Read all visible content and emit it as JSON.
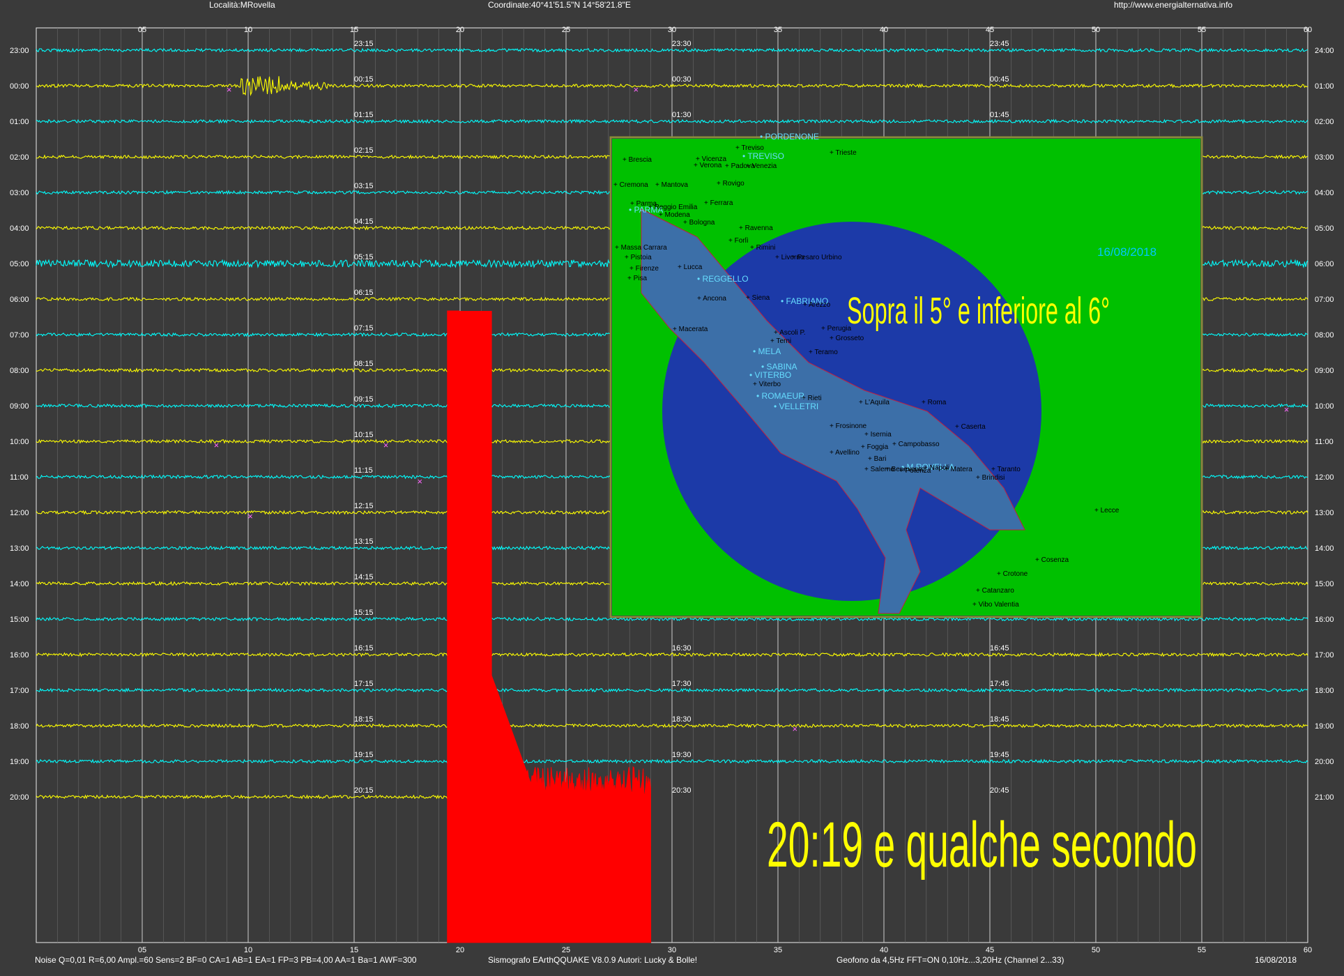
{
  "header": {
    "location": "Località:MRovella",
    "coordinates": "Coordinate:40°41'51.5\"N 14°58'21.8\"E",
    "url": "http://www.energialternativa.info"
  },
  "footer": {
    "params": "Noise Q=0,01 R=6,00 Ampl.=60 Sens=2 BF=0 CA=1 AB=1 EA=1 FP=3 PB=4,00 AA=1 Ba=1 AWF=300",
    "software": "Sismografo EArthQQUAKE  V8.0.9  Autori: Lucky & Bolle!",
    "geofono": "Geofono da 4,5Hz FFT=ON 0,10Hz...3,20Hz     (Channel 2...33)",
    "date": "16/08/2018"
  },
  "minute_ticks": [
    "05",
    "10",
    "15",
    "20",
    "25",
    "30",
    "35",
    "40",
    "45",
    "50",
    "55",
    "60"
  ],
  "rows": [
    {
      "left": "23:00",
      "right": "24:00",
      "color": "cyan",
      "marks": [
        "23:15",
        "23:30",
        "23:45"
      ]
    },
    {
      "left": "00:00",
      "right": "01:00",
      "color": "yellow",
      "marks": [
        "00:15",
        "00:30",
        "00:45"
      ]
    },
    {
      "left": "01:00",
      "right": "02:00",
      "color": "cyan",
      "marks": [
        "01:15",
        "01:30",
        "01:45"
      ]
    },
    {
      "left": "02:00",
      "right": "03:00",
      "color": "yellow",
      "marks": [
        "02:15",
        "",
        ""
      ]
    },
    {
      "left": "03:00",
      "right": "04:00",
      "color": "cyan",
      "marks": [
        "03:15",
        "",
        ""
      ]
    },
    {
      "left": "04:00",
      "right": "05:00",
      "color": "yellow",
      "marks": [
        "04:15",
        "",
        ""
      ]
    },
    {
      "left": "05:00",
      "right": "06:00",
      "color": "cyan",
      "marks": [
        "05:15",
        "",
        ""
      ]
    },
    {
      "left": "06:00",
      "right": "07:00",
      "color": "yellow",
      "marks": [
        "06:15",
        "",
        ""
      ]
    },
    {
      "left": "07:00",
      "right": "08:00",
      "color": "cyan",
      "marks": [
        "07:15",
        "",
        ""
      ]
    },
    {
      "left": "08:00",
      "right": "09:00",
      "color": "yellow",
      "marks": [
        "08:15",
        "",
        ""
      ]
    },
    {
      "left": "09:00",
      "right": "10:00",
      "color": "cyan",
      "marks": [
        "09:15",
        "",
        ""
      ]
    },
    {
      "left": "10:00",
      "right": "11:00",
      "color": "yellow",
      "marks": [
        "10:15",
        "",
        ""
      ]
    },
    {
      "left": "11:00",
      "right": "12:00",
      "color": "cyan",
      "marks": [
        "11:15",
        "",
        ""
      ]
    },
    {
      "left": "12:00",
      "right": "13:00",
      "color": "yellow",
      "marks": [
        "12:15",
        "",
        ""
      ]
    },
    {
      "left": "13:00",
      "right": "14:00",
      "color": "cyan",
      "marks": [
        "13:15",
        "",
        ""
      ]
    },
    {
      "left": "14:00",
      "right": "15:00",
      "color": "yellow",
      "marks": [
        "14:15",
        "",
        ""
      ]
    },
    {
      "left": "15:00",
      "right": "16:00",
      "color": "cyan",
      "marks": [
        "15:15",
        "",
        ""
      ]
    },
    {
      "left": "16:00",
      "right": "17:00",
      "color": "yellow",
      "marks": [
        "16:15",
        "16:30",
        "16:45"
      ]
    },
    {
      "left": "17:00",
      "right": "18:00",
      "color": "cyan",
      "marks": [
        "17:15",
        "17:30",
        "17:45"
      ]
    },
    {
      "left": "18:00",
      "right": "19:00",
      "color": "yellow",
      "marks": [
        "18:15",
        "18:30",
        "18:45"
      ]
    },
    {
      "left": "19:00",
      "right": "20:00",
      "color": "cyan",
      "marks": [
        "19:15",
        "19:30",
        "19:45"
      ]
    },
    {
      "left": "20:00",
      "right": "21:00",
      "color": "yellow",
      "marks": [
        "20:15",
        "20:30",
        "20:45"
      ]
    }
  ],
  "map": {
    "caption": "Sopra il 5° e inferiore al 6°",
    "date": "16/08/2018",
    "stations": [
      "PORDENONE",
      "TREVISO",
      "PARMA",
      "REGGELLO",
      "FABRIANO",
      "MELA",
      "SABINA",
      "VITERBO",
      "ROMAEUR",
      "VELLETRI",
      "M.ROVELLA"
    ],
    "cities": [
      "Treviso",
      "Trieste",
      "Brescia",
      "Vicenza",
      "Verona",
      "Padova",
      "Venezia",
      "Cremona",
      "Mantova",
      "Rovigo",
      "Parma",
      "Reggio Emilia",
      "Modena",
      "Ferrara",
      "Bologna",
      "Ravenna",
      "Forlì",
      "Rimini",
      "Massa Carrara",
      "Pistoia",
      "Lucca",
      "Firenze",
      "Pisa",
      "Livorno",
      "Pesaro Urbino",
      "Ancona",
      "Siena",
      "Arezzo",
      "Perugia",
      "Macerata",
      "Ascoli P.",
      "Grosseto",
      "Terni",
      "Teramo",
      "Viterbo",
      "Rieti",
      "L'Aquila",
      "Roma",
      "Frosinone",
      "Isernia",
      "Campobasso",
      "Foggia",
      "Bari",
      "Caserta",
      "Benevento",
      "Napoli",
      "Avellino",
      "Salerno",
      "Potenza",
      "Matera",
      "Brindisi",
      "Taranto",
      "Lecce",
      "Cosenza",
      "Crotone",
      "Catanzaro",
      "Vibo Valentia"
    ]
  },
  "annotation": "20:19 e qualche secondo",
  "colors": {
    "background": "#3a3a3a",
    "cyan": "#00ffff",
    "yellow": "#ffff00",
    "event": "#ff0000",
    "grid": "#dddddd",
    "marker": "#ff66ff",
    "map_sea": "#1a2a9a",
    "map_land": "#00c000"
  }
}
